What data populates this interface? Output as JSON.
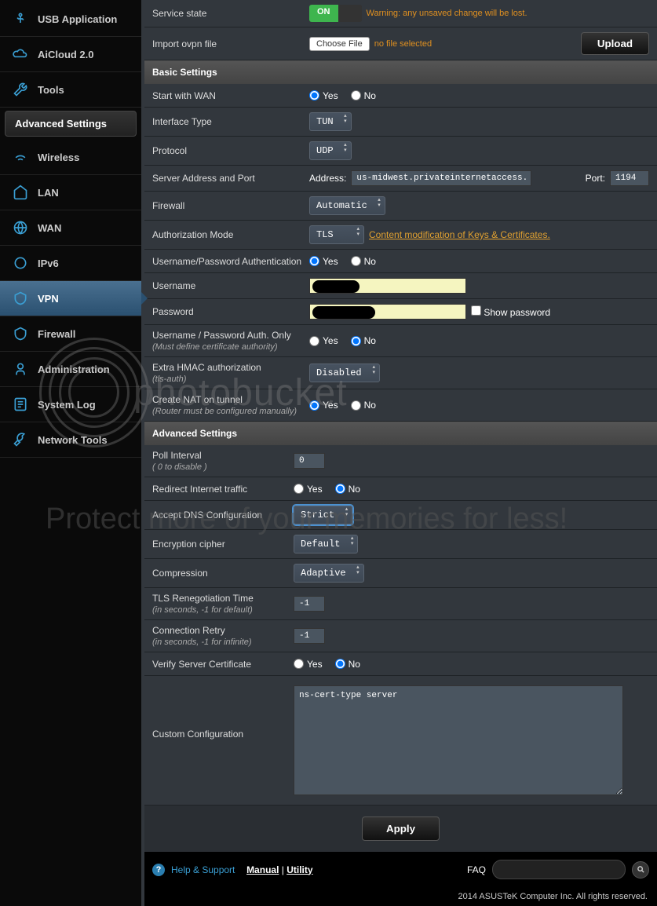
{
  "sidebar": {
    "topItems": [
      {
        "label": "USB Application"
      },
      {
        "label": "AiCloud 2.0"
      },
      {
        "label": "Tools"
      }
    ],
    "sectionTitle": "Advanced Settings",
    "advItems": [
      {
        "label": "Wireless"
      },
      {
        "label": "LAN"
      },
      {
        "label": "WAN"
      },
      {
        "label": "IPv6"
      },
      {
        "label": "VPN"
      },
      {
        "label": "Firewall"
      },
      {
        "label": "Administration"
      },
      {
        "label": "System Log"
      },
      {
        "label": "Network Tools"
      }
    ]
  },
  "settings": {
    "serviceState": {
      "label": "Service state",
      "on": "ON",
      "warning": "Warning: any unsaved change will be lost."
    },
    "importFile": {
      "label": "Import ovpn file",
      "choose": "Choose File",
      "status": "no file selected",
      "upload": "Upload"
    },
    "basicHeader": "Basic Settings",
    "startWan": {
      "label": "Start with WAN",
      "yes": "Yes",
      "no": "No"
    },
    "interfaceType": {
      "label": "Interface Type",
      "value": "TUN"
    },
    "protocol": {
      "label": "Protocol",
      "value": "UDP"
    },
    "server": {
      "label": "Server Address and Port",
      "addrLabel": "Address:",
      "addr": "us-midwest.privateinternetaccess.",
      "portLabel": "Port:",
      "port": "1194"
    },
    "firewall": {
      "label": "Firewall",
      "value": "Automatic"
    },
    "authMode": {
      "label": "Authorization Mode",
      "value": "TLS",
      "link": "Content modification of Keys & Certificates."
    },
    "userpassAuth": {
      "label": "Username/Password Authentication",
      "yes": "Yes",
      "no": "No"
    },
    "username": {
      "label": "Username"
    },
    "password": {
      "label": "Password",
      "show": "Show password"
    },
    "authOnly": {
      "label": "Username / Password Auth. Only",
      "sub": "(Must define certificate authority)",
      "yes": "Yes",
      "no": "No"
    },
    "hmac": {
      "label": "Extra HMAC authorization",
      "sub": "(tls-auth)",
      "value": "Disabled"
    },
    "nat": {
      "label": "Create NAT on tunnel",
      "sub": "(Router must be configured manually)",
      "yes": "Yes",
      "no": "No"
    },
    "advHeader": "Advanced Settings",
    "poll": {
      "label": "Poll Interval",
      "sub": "( 0 to disable )",
      "value": "0"
    },
    "redirect": {
      "label": "Redirect Internet traffic",
      "yes": "Yes",
      "no": "No"
    },
    "dns": {
      "label": "Accept DNS Configuration",
      "value": "Strict"
    },
    "cipher": {
      "label": "Encryption cipher",
      "value": "Default"
    },
    "compression": {
      "label": "Compression",
      "value": "Adaptive"
    },
    "tlsReneg": {
      "label": "TLS Renegotiation Time",
      "sub": "(in seconds, -1 for default)",
      "value": "-1"
    },
    "connRetry": {
      "label": "Connection Retry",
      "sub": "(in seconds, -1 for infinite)",
      "value": "-1"
    },
    "verifyCert": {
      "label": "Verify Server Certificate",
      "yes": "Yes",
      "no": "No"
    },
    "custom": {
      "label": "Custom Configuration",
      "value": "ns-cert-type server"
    },
    "apply": "Apply"
  },
  "footer": {
    "help": "Help & Support",
    "manual": "Manual",
    "utility": "Utility",
    "faq": "FAQ",
    "copyright": "2014 ASUSTeK Computer Inc. All rights reserved."
  },
  "watermark": {
    "brand": "photobucket",
    "tagline": "Protect more of your memories for less!"
  }
}
